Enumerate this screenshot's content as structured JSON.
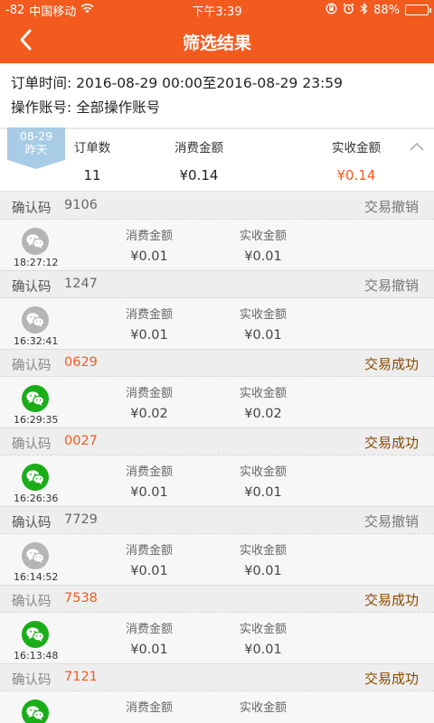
{
  "status_bar": {
    "signal": "-82",
    "carrier": "中国移动",
    "time": "下午3:39",
    "battery": "88%",
    "battery_level": 0.88
  },
  "nav": {
    "title": "筛选结果"
  },
  "filter": {
    "time_line": "订单时间: 2016-08-29 00:00至2016-08-29 23:59",
    "account_line": "操作账号: 全部操作账号"
  },
  "summary": {
    "date": "08-29",
    "day": "昨天",
    "order_count_label": "订单数",
    "consume_label": "消费金额",
    "received_label": "实收金额",
    "order_count": "11",
    "consume": "¥0.14",
    "received": "¥0.14"
  },
  "orders": [
    {
      "code_label": "确认码",
      "code": "9106",
      "status": "交易撤销",
      "state": "cancel",
      "time": "18:27:12",
      "consume_label": "消费金额",
      "received_label": "实收金额",
      "consume": "¥0.01",
      "received": "¥0.01"
    },
    {
      "code_label": "确认码",
      "code": "1247",
      "status": "交易撤销",
      "state": "cancel",
      "time": "16:32:41",
      "consume_label": "消费金额",
      "received_label": "实收金额",
      "consume": "¥0.01",
      "received": "¥0.01"
    },
    {
      "code_label": "确认码",
      "code": "0629",
      "status": "交易成功",
      "state": "success",
      "time": "16:29:35",
      "consume_label": "消费金额",
      "received_label": "实收金额",
      "consume": "¥0.02",
      "received": "¥0.02"
    },
    {
      "code_label": "确认码",
      "code": "0027",
      "status": "交易成功",
      "state": "success",
      "time": "16:26:36",
      "consume_label": "消费金额",
      "received_label": "实收金额",
      "consume": "¥0.01",
      "received": "¥0.01"
    },
    {
      "code_label": "确认码",
      "code": "7729",
      "status": "交易撤销",
      "state": "cancel",
      "time": "16:14:52",
      "consume_label": "消费金额",
      "received_label": "实收金额",
      "consume": "¥0.01",
      "received": "¥0.01"
    },
    {
      "code_label": "确认码",
      "code": "7538",
      "status": "交易成功",
      "state": "success",
      "time": "16:13:48",
      "consume_label": "消费金额",
      "received_label": "实收金额",
      "consume": "¥0.01",
      "received": "¥0.01"
    },
    {
      "code_label": "确认码",
      "code": "7121",
      "status": "交易成功",
      "state": "success",
      "time": "",
      "consume_label": "消费金额",
      "received_label": "实收金额",
      "consume": "",
      "received": ""
    }
  ],
  "colors": {
    "brand": "#f25a1e",
    "wechat_green": "#1aad19",
    "wechat_gray": "#b5b5b5",
    "badge_blue": "#a8cbe6"
  },
  "icons": {
    "back": "chevron-left-icon",
    "collapse": "chevron-up-icon",
    "payment_method": "wechat-icon"
  }
}
